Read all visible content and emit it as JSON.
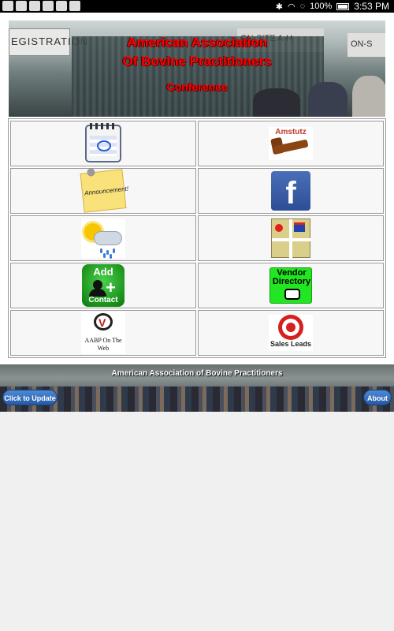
{
  "status_bar": {
    "battery": "100%",
    "time": "3:53 PM"
  },
  "banner": {
    "title_line1": "American Association",
    "title_line2": "Of Bovine Practitioners",
    "subtitle": "Conference",
    "booth_signs": [
      "EGISTRATION",
      "ON-SITE A-H",
      "ON-S"
    ]
  },
  "tiles": {
    "calendar": "",
    "amstutz": "Amstutz",
    "announcement": "Announcement!",
    "facebook": "f",
    "weather": "",
    "map": "",
    "add_contact_top": "Add",
    "add_contact_bottom": "Contact",
    "vendor_directory": "Vendor Directory",
    "aabp_web": "AABP On The Web",
    "sales_leads": "Sales Leads"
  },
  "footer": {
    "title": "American Association of Bovine Practitioners",
    "update_button": "Click to Update",
    "about_button": "About"
  },
  "colors": {
    "title_red": "#ff0000",
    "button_blue": "#245aa6",
    "vendor_green": "#22e622"
  }
}
